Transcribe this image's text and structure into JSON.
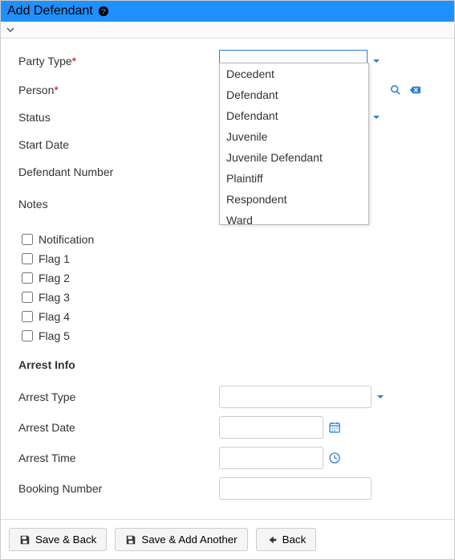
{
  "header": {
    "title": "Add Defendant"
  },
  "labels": {
    "party_type": "Party Type",
    "person": "Person",
    "status": "Status",
    "start_date": "Start Date",
    "defendant_number": "Defendant Number",
    "notes": "Notes",
    "arrest_info": "Arrest Info",
    "arrest_type": "Arrest Type",
    "arrest_date": "Arrest Date",
    "arrest_time": "Arrest Time",
    "booking_number": "Booking Number"
  },
  "party_type": {
    "value": "",
    "options": [
      "Decedent",
      "Defendant",
      "Defendant",
      "Juvenile",
      "Juvenile Defendant",
      "Plaintiff",
      "Respondent",
      "Ward"
    ]
  },
  "checkboxes": {
    "notification": {
      "label": "Notification",
      "checked": false
    },
    "flag1": {
      "label": "Flag 1",
      "checked": false
    },
    "flag2": {
      "label": "Flag 2",
      "checked": false
    },
    "flag3": {
      "label": "Flag 3",
      "checked": false
    },
    "flag4": {
      "label": "Flag 4",
      "checked": false
    },
    "flag5": {
      "label": "Flag 5",
      "checked": false
    }
  },
  "arrest": {
    "type": "",
    "date": "",
    "time": "",
    "booking_number": ""
  },
  "buttons": {
    "save_back": "Save & Back",
    "save_add_another": "Save & Add Another",
    "back": "Back"
  }
}
